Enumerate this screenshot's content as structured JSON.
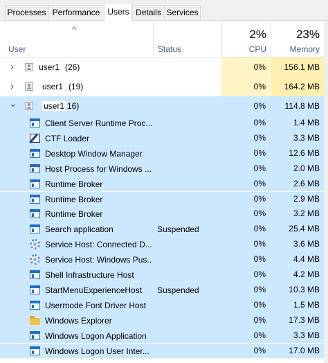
{
  "tabs": [
    "Processes",
    "Performance",
    "Users",
    "Details",
    "Services"
  ],
  "active_tab": "Users",
  "columns": {
    "user": "User",
    "status": "Status",
    "cpu_label": "CPU",
    "cpu_pct": "2%",
    "memory_label": "Memory",
    "memory_pct": "23%"
  },
  "users": [
    {
      "name": "user1",
      "count": "(26)",
      "cpu": "0%",
      "memory": "156.1 MB",
      "expanded": false
    },
    {
      "name": "user1",
      "count": "(19)",
      "cpu": "0%",
      "memory": "164.2 MB",
      "expanded": false
    },
    {
      "name": "user1",
      "count": "16)",
      "cpu": "0%",
      "memory": "114.8 MB",
      "expanded": true
    }
  ],
  "processes": [
    {
      "name": "Client Server Runtime Proc...",
      "status": "",
      "cpu": "0%",
      "memory": "1.4 MB",
      "icon": "window-icon"
    },
    {
      "name": "CTF Loader",
      "status": "",
      "cpu": "0%",
      "memory": "3.3 MB",
      "icon": "pen-icon"
    },
    {
      "name": "Desktop Window Manager",
      "status": "",
      "cpu": "0%",
      "memory": "12.6 MB",
      "icon": "window-icon"
    },
    {
      "name": "Host Process for Windows ...",
      "status": "",
      "cpu": "0%",
      "memory": "2.0 MB",
      "icon": "window-icon"
    },
    {
      "name": "Runtime Broker",
      "status": "",
      "cpu": "0%",
      "memory": "2.6 MB",
      "icon": "window-icon"
    },
    {
      "name": "Runtime Broker",
      "status": "",
      "cpu": "0%",
      "memory": "2.9 MB",
      "icon": "window-icon"
    },
    {
      "name": "Runtime Broker",
      "status": "",
      "cpu": "0%",
      "memory": "3.2 MB",
      "icon": "window-icon"
    },
    {
      "name": "Search application",
      "status": "Suspended",
      "cpu": "0%",
      "memory": "25.4 MB",
      "icon": "window-icon"
    },
    {
      "name": "Service Host: Connected D...",
      "status": "",
      "cpu": "0%",
      "memory": "3.6 MB",
      "icon": "gear-icon"
    },
    {
      "name": "Service Host: Windows Pus...",
      "status": "",
      "cpu": "0%",
      "memory": "4.4 MB",
      "icon": "gear-icon"
    },
    {
      "name": "Shell Infrastructure Host",
      "status": "",
      "cpu": "0%",
      "memory": "4.2 MB",
      "icon": "window-icon"
    },
    {
      "name": "StartMenuExperienceHost",
      "status": "Suspended",
      "cpu": "0%",
      "memory": "10.3 MB",
      "icon": "window-icon"
    },
    {
      "name": "Usermode Font Driver Host",
      "status": "",
      "cpu": "0%",
      "memory": "1.5 MB",
      "icon": "window-icon"
    },
    {
      "name": "Windows Explorer",
      "status": "",
      "cpu": "0%",
      "memory": "17.3 MB",
      "icon": "folder-icon"
    },
    {
      "name": "Windows Logon Application",
      "status": "",
      "cpu": "0%",
      "memory": "3.3 MB",
      "icon": "window-icon"
    },
    {
      "name": "Windows Logon User Inter...",
      "status": "",
      "cpu": "0%",
      "memory": "17.0 MB",
      "icon": "window-icon"
    }
  ],
  "colors": {
    "selected_row": "#cce8ff",
    "heat_cpu": "#fff4c4",
    "heat_memory": "#ffefb0",
    "header_text": "#4c607a"
  }
}
